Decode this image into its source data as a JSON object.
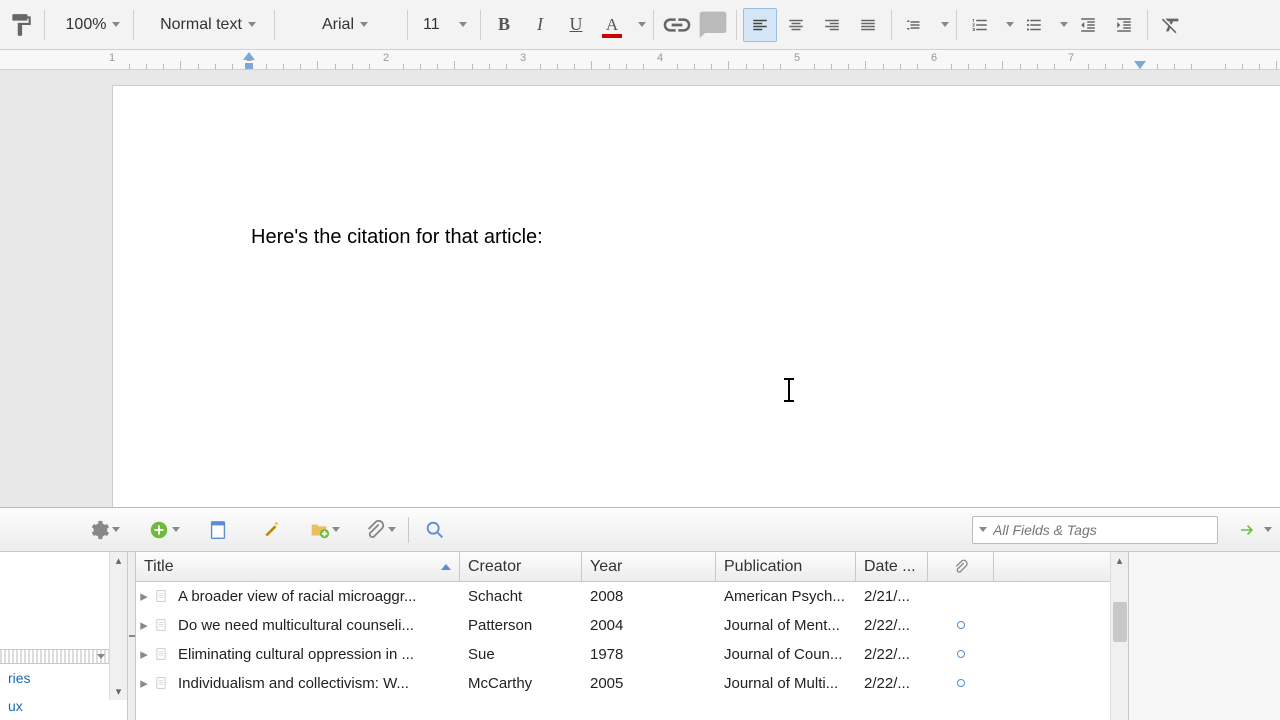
{
  "toolbar": {
    "zoom": "100%",
    "style": "Normal text",
    "font": "Arial",
    "size": "11"
  },
  "ruler": {
    "numbers": [
      "1",
      "1",
      "2",
      "3",
      "4",
      "5",
      "6",
      "7"
    ]
  },
  "document": {
    "body": "Here's the citation for that article:"
  },
  "ref": {
    "search_placeholder": "All Fields & Tags",
    "folders": [
      "ries",
      "ux"
    ],
    "columns": {
      "title": "Title",
      "creator": "Creator",
      "year": "Year",
      "publication": "Publication",
      "date": "Date ..."
    },
    "rows": [
      {
        "title": "A broader view of racial microaggr...",
        "creator": "Schacht",
        "year": "2008",
        "publication": "American Psych...",
        "date": "2/21/...",
        "tag": false
      },
      {
        "title": "Do we need multicultural counseli...",
        "creator": "Patterson",
        "year": "2004",
        "publication": "Journal of Ment...",
        "date": "2/22/...",
        "tag": true
      },
      {
        "title": "Eliminating cultural oppression in ...",
        "creator": "Sue",
        "year": "1978",
        "publication": "Journal of Coun...",
        "date": "2/22/...",
        "tag": true
      },
      {
        "title": "Individualism and collectivism: W...",
        "creator": "McCarthy",
        "year": "2005",
        "publication": "Journal of Multi...",
        "date": "2/22/...",
        "tag": true
      }
    ]
  }
}
